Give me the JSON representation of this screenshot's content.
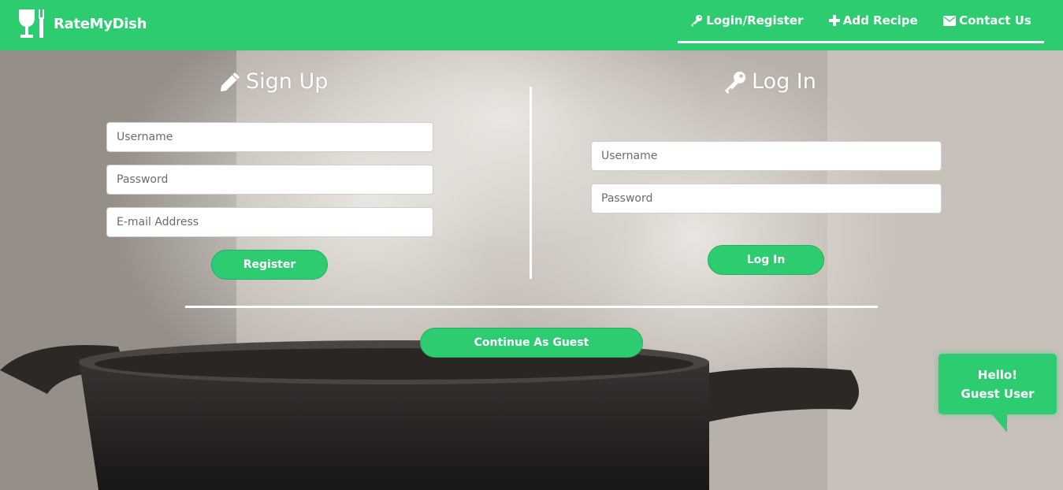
{
  "brand": {
    "name": "RateMyDish"
  },
  "nav": {
    "items": [
      {
        "label": "Login/Register",
        "icon": "key-icon"
      },
      {
        "label": "Add Recipe",
        "icon": "plus-icon"
      },
      {
        "label": "Contact Us",
        "icon": "envelope-icon"
      }
    ]
  },
  "signup": {
    "title": "Sign Up",
    "username_placeholder": "Username",
    "password_placeholder": "Password",
    "email_placeholder": "E-mail Address",
    "button_label": "Register"
  },
  "login": {
    "title": "Log In",
    "username_placeholder": "Username",
    "password_placeholder": "Password",
    "button_label": "Log In"
  },
  "guest": {
    "button_label": "Continue As Guest"
  },
  "greeting": {
    "line1": "Hello!",
    "line2": "Guest User"
  },
  "colors": {
    "accent": "#2ecc71",
    "text": "#ffffff"
  }
}
